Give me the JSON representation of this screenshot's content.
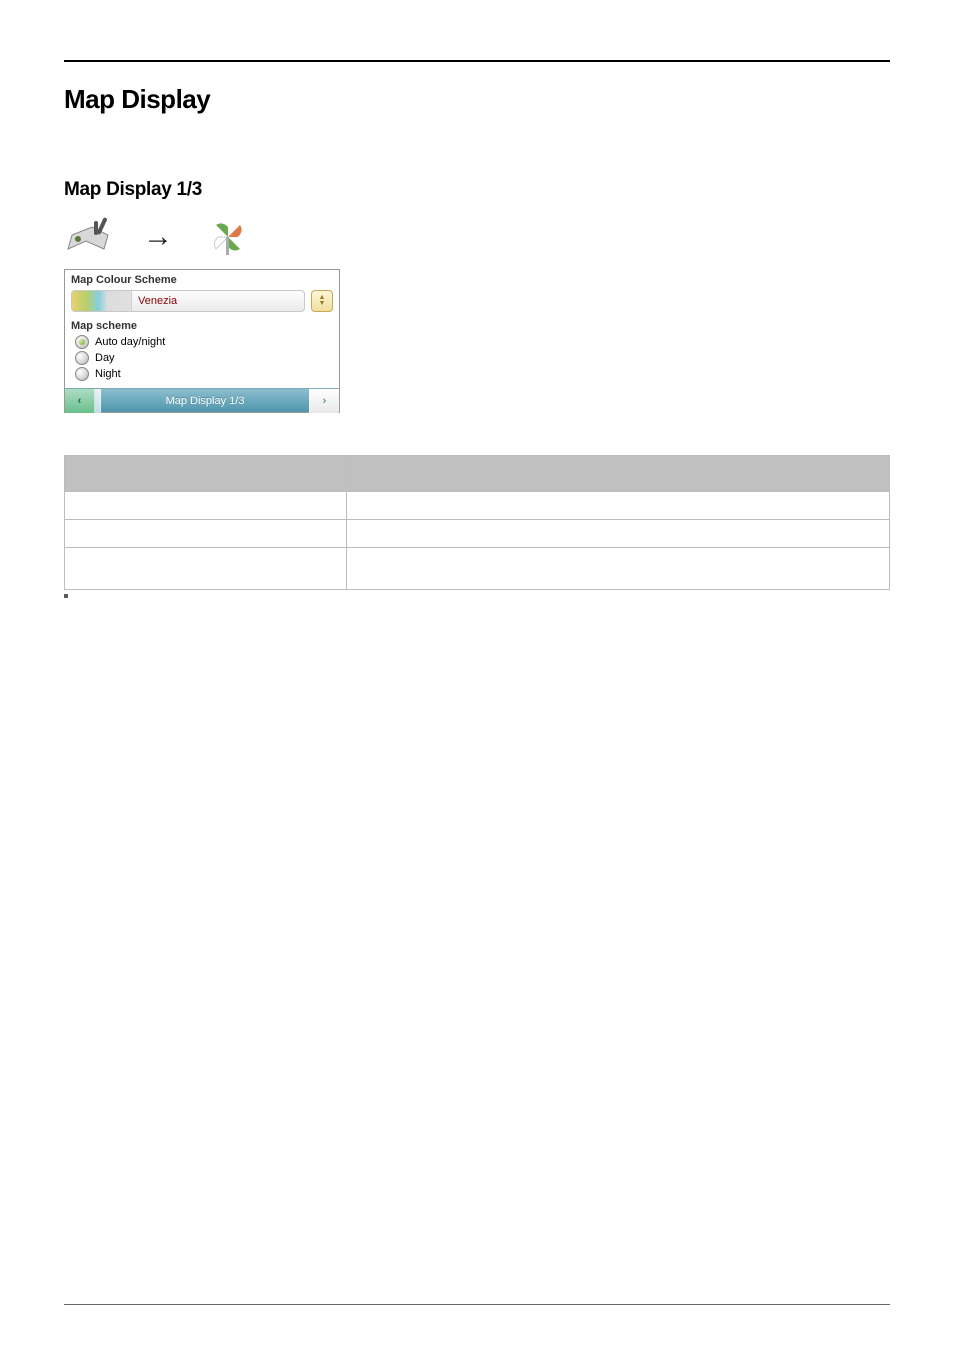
{
  "page_heading": "Map Display",
  "subheading": "Map Display 1/3",
  "device": {
    "header_label": "Map Colour Scheme",
    "scheme_selected": "Venezia",
    "map_scheme_label": "Map scheme",
    "options": [
      {
        "label": "Auto day/night",
        "selected": true
      },
      {
        "label": "Day",
        "selected": false
      },
      {
        "label": "Night",
        "selected": false
      }
    ],
    "footer_title": "Map Display 1/3"
  },
  "icons": {
    "left": "tools-map-icon",
    "arrow": "→",
    "right": "pinwheel-icon"
  },
  "table": {
    "headers": [
      "",
      ""
    ],
    "rows": [
      {
        "setting": "",
        "description": "",
        "tall": false
      },
      {
        "setting": "",
        "description": "",
        "tall": false
      },
      {
        "setting": "",
        "description": "",
        "tall": true
      }
    ]
  }
}
